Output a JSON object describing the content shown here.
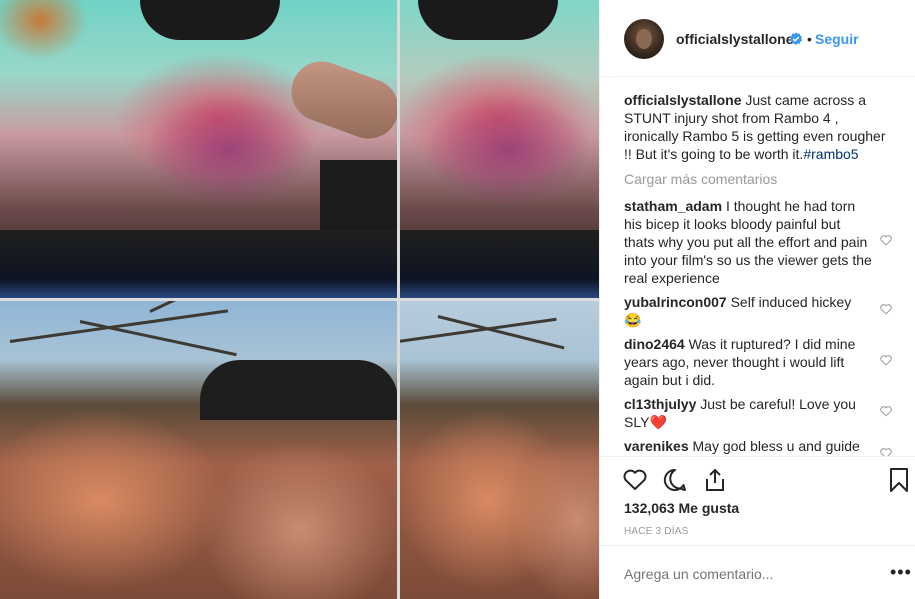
{
  "post": {
    "username": "officialslystallone",
    "separator": "•",
    "follow_label": "Seguir",
    "verified_icon": "verified-badge-icon",
    "accent_color": "#3897f0"
  },
  "caption": {
    "username": "officialslystallone",
    "text": "Just came across a STUNT injury shot from Rambo 4 , ironically Rambo 5 is getting even rougher !! But it's going to be worth it.",
    "hashtag": "#rambo5"
  },
  "load_more_label": "Cargar más comentarios",
  "comments": [
    {
      "user": "statham_adam",
      "text": "I thought he had torn his bicep it looks bloody painful but thats why you put all the effort and pain into your film's so us the viewer gets the real experience",
      "emoji": ""
    },
    {
      "user": "yubalrincon007",
      "text": "Self induced hickey",
      "emoji": "😂"
    },
    {
      "user": "dino2464",
      "text": "Was it ruptured? I did mine years ago, never thought i would lift again but i did.",
      "emoji": ""
    },
    {
      "user": "cl13thjulyy",
      "text": "Just be careful! Love you SLY",
      "emoji": "❤️"
    },
    {
      "user": "varenikes",
      "text": "May god bless u and guide",
      "emoji": ""
    }
  ],
  "likes_label": "132,063 Me gusta",
  "time_label": "HACE 3 DÍAS",
  "add_comment_placeholder": "Agrega un comentario...",
  "more_label": "•••"
}
